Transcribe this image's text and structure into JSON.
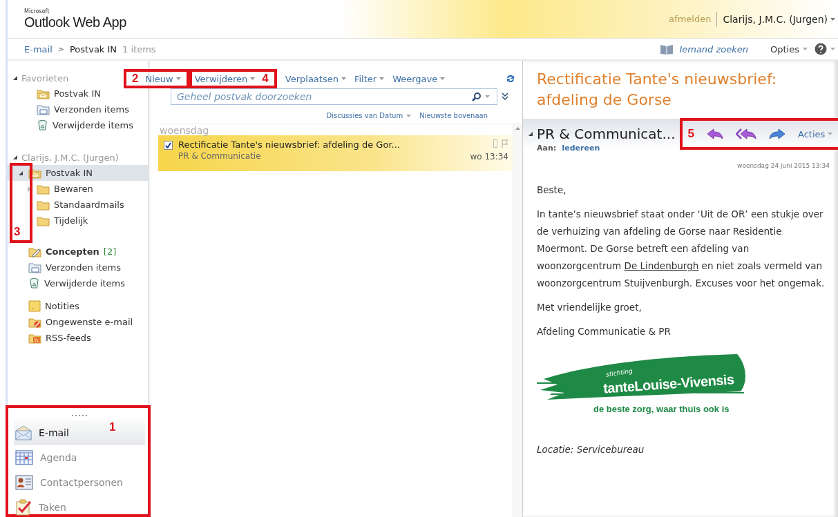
{
  "header": {
    "brand_small": "Microsoft",
    "brand": "Outlook Web App",
    "signout": "afmelden",
    "user": "Clarijs, J.M.C. (Jurgen)"
  },
  "breadcrumb": {
    "root": "E-mail",
    "separator": ">",
    "folder": "Postvak IN",
    "count": "1 items",
    "people_search": "Iemand zoeken",
    "options": "Opties"
  },
  "sidebar": {
    "favorites": {
      "label": "Favorieten",
      "expanded": true,
      "folders": [
        {
          "kind": "inbox",
          "label": "Postvak IN",
          "selected": false
        },
        {
          "kind": "sent",
          "label": "Verzonden items",
          "selected": false
        },
        {
          "kind": "deleted",
          "label": "Verwijderde items",
          "selected": false
        }
      ]
    },
    "mailbox": {
      "label": "Clarijs, J.M.C. (Jurgen)",
      "expanded": true,
      "groups": [
        {
          "annotation": "3",
          "folders": [
            {
              "kind": "inbox",
              "label": "Postvak IN",
              "expanded": true,
              "selected": true,
              "children": [
                {
                  "kind": "folder",
                  "label": "Bewaren",
                  "expanded": false,
                  "selected": false
                },
                {
                  "kind": "folder",
                  "label": "Standaardmails",
                  "selected": false
                },
                {
                  "kind": "folder",
                  "label": "Tijdelijk",
                  "selected": false
                }
              ]
            }
          ]
        },
        {
          "folders": [
            {
              "kind": "drafts",
              "label": "Concepten",
              "count": "[2]",
              "unread": true,
              "selected": false
            },
            {
              "kind": "sent",
              "label": "Verzonden items",
              "selected": false
            },
            {
              "kind": "deleted",
              "label": "Verwijderde items",
              "selected": false
            }
          ]
        },
        {
          "folders": [
            {
              "kind": "notes",
              "label": "Notities",
              "selected": false
            },
            {
              "kind": "junk",
              "label": "Ongewenste e-mail",
              "selected": false
            },
            {
              "kind": "rss",
              "label": "RSS-feeds",
              "selected": false
            }
          ]
        }
      ]
    },
    "nav_bar": {
      "annotation": "1",
      "items": [
        {
          "kind": "mail",
          "label": "E-mail",
          "selected": true
        },
        {
          "kind": "calendar",
          "label": "Agenda",
          "selected": false
        },
        {
          "kind": "contacts",
          "label": "Contactpersonen",
          "selected": false
        },
        {
          "kind": "tasks",
          "label": "Taken",
          "selected": false
        }
      ]
    }
  },
  "toolbar": {
    "items": [
      {
        "label": "Nieuw",
        "dropdown": true,
        "annotation": "2"
      },
      {
        "label": "Verwijderen",
        "dropdown": true,
        "annotation": "4"
      },
      {
        "label": "Verplaatsen",
        "dropdown": true
      },
      {
        "label": "Filter",
        "dropdown": true
      },
      {
        "label": "Weergave",
        "dropdown": true
      }
    ]
  },
  "search": {
    "placeholder": "Geheel postvak doorzoeken"
  },
  "sort": {
    "arrange": "Discussies van Datum",
    "order": "Nieuwste bovenaan"
  },
  "message_groups": [
    {
      "label": "woensdag",
      "messages": [
        {
          "subject": "Rectificatie Tante's nieuwsbrief: afdeling de Gor...",
          "from": "PR & Communicatie",
          "time": "wo 13:34",
          "checked": true,
          "selected": true
        }
      ]
    }
  ],
  "reading_pane": {
    "title": "Rectificatie Tante's nieuwsbrief: afdeling de Gorse",
    "sender": "PR & Communicat...",
    "to_label": "Aan:",
    "to": "Iedereen",
    "date": "woensdag 24 juni 2015 13:34",
    "actions": {
      "annotation": "5",
      "buttons": [
        {
          "kind": "reply"
        },
        {
          "kind": "reply_all"
        },
        {
          "kind": "forward"
        }
      ],
      "more": "Acties"
    },
    "body": [
      {
        "kind": "text",
        "parts": [
          {
            "text": "Beste,"
          }
        ]
      },
      {
        "kind": "text",
        "parts": [
          {
            "text": "In tante’s nieuwsbrief staat onder ‘Uit de OR’ een stukje over de verhuizing van afdeling de Gorse naar Residentie Moermont. De Gorse betreft een afdeling van woonzorgcentrum "
          },
          {
            "text": "De Lindenburgh",
            "link": true
          },
          {
            "text": " en niet zoals vermeld van woonzorgcentrum Stuijvenburgh. Excuses voor het ongemak."
          }
        ]
      },
      {
        "kind": "text",
        "parts": [
          {
            "text": "Met vriendelijke groet,"
          }
        ]
      },
      {
        "kind": "text",
        "parts": [
          {
            "text": "Afdeling Communicatie & PR"
          }
        ]
      },
      {
        "kind": "logo",
        "small": "stichting",
        "name": "tanteLouise-Vivensis",
        "tagline": "de beste zorg, waar thuis ook is"
      },
      {
        "kind": "italic",
        "parts": [
          {
            "text": "Locatie: Servicebureau"
          }
        ]
      }
    ]
  }
}
